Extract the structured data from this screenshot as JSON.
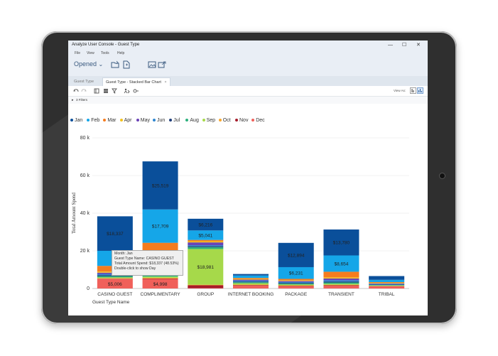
{
  "window": {
    "title": "Analyze User Console - Guest Type",
    "minimize": "—",
    "maximize": "☐",
    "close": "✕"
  },
  "menu": [
    "File",
    "View",
    "Tools",
    "Help"
  ],
  "toolbar": {
    "opened_label": "Opened",
    "opened_chevron": "⌄"
  },
  "tabs": [
    {
      "label": "Guest Type",
      "active": false
    },
    {
      "label": "Guest Type - Stacked Bar Chart",
      "active": true,
      "close": "×"
    }
  ],
  "chart_toolbar": {
    "view_as_label": "View As:"
  },
  "filters": {
    "label": "3 Filters"
  },
  "tooltip": {
    "lines": [
      "Month: Jan",
      "Guest Type Name: CASINO GUEST",
      "Total Amount Spend: $18,337 (48.53%)",
      "Double-click to show Day"
    ]
  },
  "chart_data": {
    "type": "bar",
    "stacked": true,
    "xlabel": "Guest Type Name",
    "ylabel": "Total Amount Spend",
    "ylim": [
      0,
      80000
    ],
    "yticks": [
      "0",
      "20 k",
      "40 k",
      "60 k",
      "80 k"
    ],
    "categories": [
      "CASINO GUEST",
      "COMPLIMENTARY",
      "GROUP",
      "INTERNET BOOKING",
      "PACKAGE",
      "TRANSIENT",
      "TRIBAL"
    ],
    "legend_position": "top-left",
    "series": [
      {
        "name": "Jan",
        "color": "#0a4f9a",
        "values": [
          18337,
          25519,
          6216,
          800,
          12894,
          13780,
          2000
        ]
      },
      {
        "name": "Feb",
        "color": "#15a6e8",
        "values": [
          8000,
          17709,
          5041,
          1300,
          6231,
          8654,
          1200
        ]
      },
      {
        "name": "Mar",
        "color": "#f57c1f",
        "values": [
          3000,
          14376,
          700,
          500,
          700,
          3000,
          400
        ]
      },
      {
        "name": "Apr",
        "color": "#f4c21c",
        "values": [
          600,
          500,
          600,
          400,
          400,
          600,
          300
        ]
      },
      {
        "name": "May",
        "color": "#6b43b6",
        "values": [
          700,
          900,
          1500,
          500,
          500,
          900,
          300
        ]
      },
      {
        "name": "Jun",
        "color": "#2f86d0",
        "values": [
          600,
          700,
          500,
          500,
          500,
          700,
          300
        ]
      },
      {
        "name": "Jul",
        "color": "#1f3e7a",
        "values": [
          500,
          700,
          500,
          400,
          400,
          500,
          200
        ]
      },
      {
        "name": "Aug",
        "color": "#2cb07d",
        "values": [
          700,
          800,
          1000,
          500,
          500,
          700,
          300
        ]
      },
      {
        "name": "Sep",
        "color": "#a6d94a",
        "values": [
          400,
          600,
          18981,
          700,
          400,
          500,
          200
        ]
      },
      {
        "name": "Oct",
        "color": "#f9a72e",
        "values": [
          300,
          400,
          300,
          300,
          300,
          300,
          200
        ]
      },
      {
        "name": "Nov",
        "color": "#a51c2b",
        "values": [
          200,
          300,
          1500,
          300,
          300,
          300,
          200
        ]
      },
      {
        "name": "Dec",
        "color": "#f0605a",
        "values": [
          5006,
          4998,
          200,
          1500,
          1100,
          1400,
          1000
        ]
      }
    ],
    "data_labels": [
      {
        "category": "CASINO GUEST",
        "series": "Jan",
        "text": "$18,337"
      },
      {
        "category": "CASINO GUEST",
        "series": "Dec",
        "text": "$5,006"
      },
      {
        "category": "COMPLIMENTARY",
        "series": "Jan",
        "text": "$25,519"
      },
      {
        "category": "COMPLIMENTARY",
        "series": "Feb",
        "text": "$17,709"
      },
      {
        "category": "COMPLIMENTARY",
        "series": "Mar",
        "text": "$14,376"
      },
      {
        "category": "COMPLIMENTARY",
        "series": "Dec",
        "text": "$4,998"
      },
      {
        "category": "GROUP",
        "series": "Jan",
        "text": "$6,216"
      },
      {
        "category": "GROUP",
        "series": "Feb",
        "text": "$5,041"
      },
      {
        "category": "GROUP",
        "series": "Sep",
        "text": "$18,981"
      },
      {
        "category": "PACKAGE",
        "series": "Jan",
        "text": "$12,894"
      },
      {
        "category": "PACKAGE",
        "series": "Feb",
        "text": "$6,231"
      },
      {
        "category": "TRANSIENT",
        "series": "Jan",
        "text": "$13,780"
      },
      {
        "category": "TRANSIENT",
        "series": "Feb",
        "text": "$8,654"
      }
    ],
    "grid": true
  }
}
